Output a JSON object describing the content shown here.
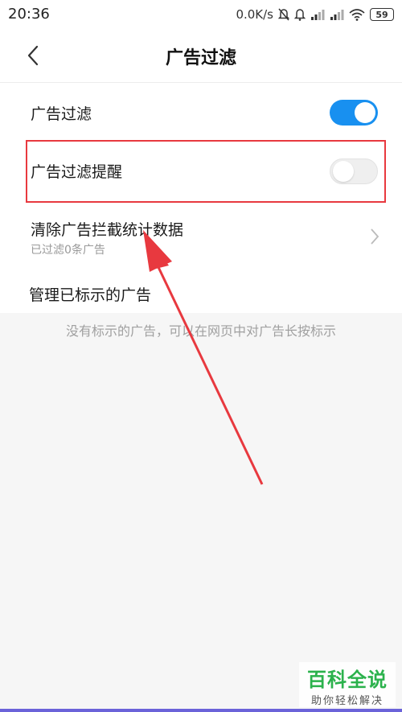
{
  "status_bar": {
    "time": "20:36",
    "speed": "0.0K/s",
    "battery": "59"
  },
  "header": {
    "title": "广告过滤"
  },
  "settings": {
    "ad_filter": {
      "label": "广告过滤",
      "enabled": true
    },
    "ad_filter_reminder": {
      "label": "广告过滤提醒",
      "enabled": false
    },
    "clear_stats": {
      "label": "清除广告拦截统计数据",
      "sub": "已过滤0条广告"
    }
  },
  "marked_ads": {
    "title": "管理已标示的广告",
    "empty_hint": "没有标示的广告，可以在网页中对广告长按标示"
  },
  "watermark": {
    "main": "百科全说",
    "sub": "助你轻松解决"
  },
  "colors": {
    "accent": "#1890f0",
    "annotation": "#e8393f",
    "watermark": "#2bb24c"
  }
}
